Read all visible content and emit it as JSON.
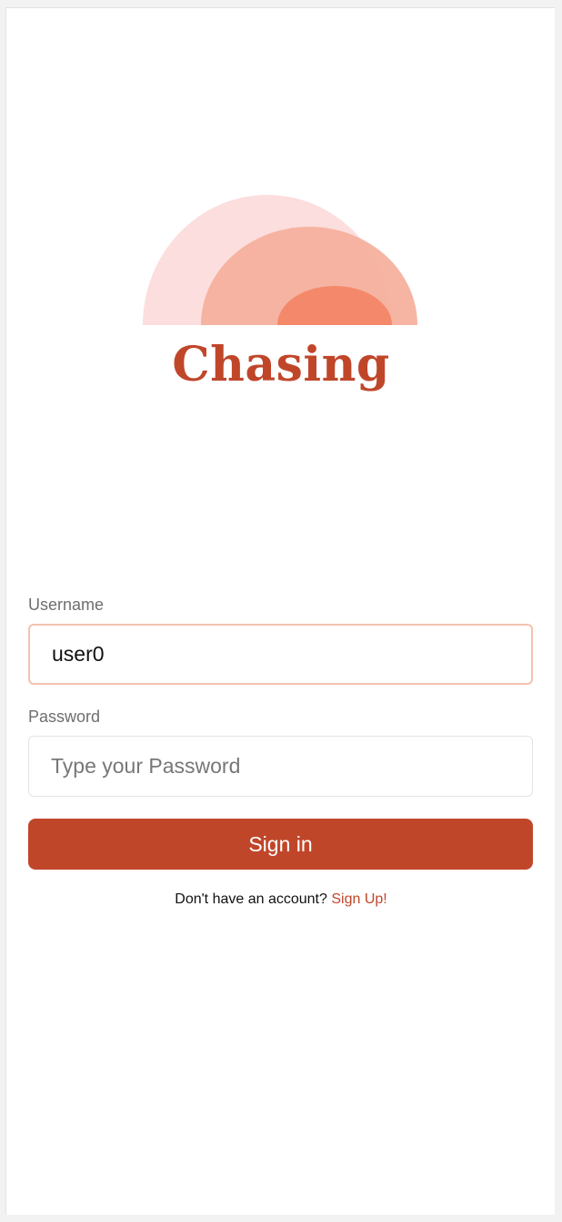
{
  "brand": {
    "name": "Chasing",
    "colors": {
      "primary": "#C0462A",
      "arc_light": "#FBDEDD",
      "arc_mid": "#F5AF9B",
      "arc_dark": "#F3896A"
    }
  },
  "logo": {
    "icon": "sunrise-arcs-icon"
  },
  "form": {
    "username": {
      "label": "Username",
      "value": "user0",
      "focused": true
    },
    "password": {
      "label": "Password",
      "value": "",
      "placeholder": "Type your Password"
    },
    "submit_label": "Sign in"
  },
  "signup": {
    "prompt": "Don't have an account?",
    "link_label": "Sign Up!"
  }
}
